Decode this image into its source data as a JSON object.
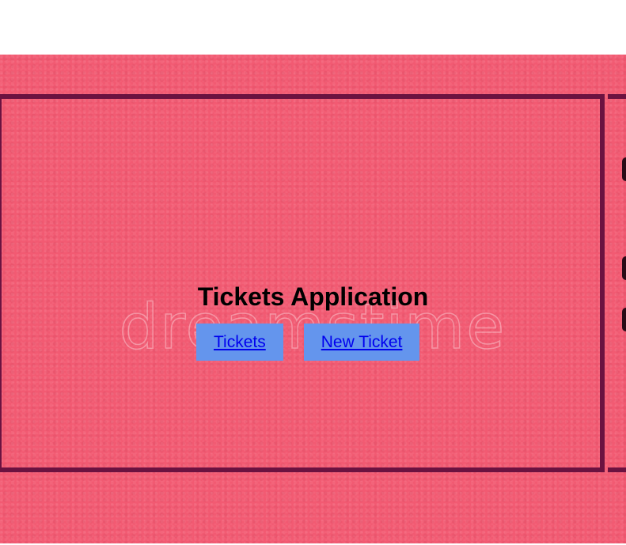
{
  "app": {
    "title": "Tickets Application"
  },
  "nav": {
    "items": [
      {
        "label": "Tickets"
      },
      {
        "label": "New Ticket"
      }
    ]
  },
  "background": {
    "color": "#f25a72",
    "border_color": "#6b1240",
    "watermark": "dreamstime"
  },
  "colors": {
    "button_bg": "#6495ed",
    "link": "#0000ee"
  }
}
